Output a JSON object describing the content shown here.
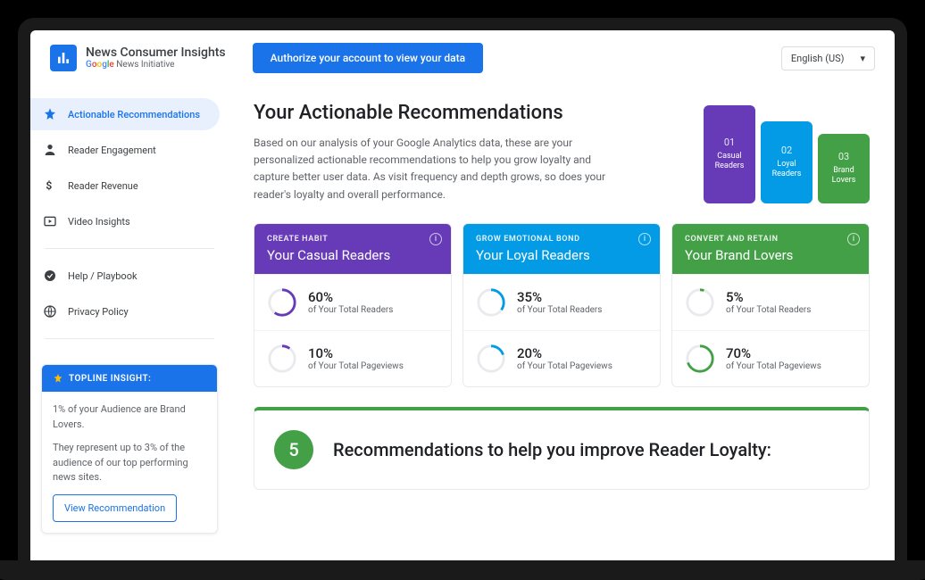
{
  "header": {
    "title": "News Consumer Insights",
    "subtitle_suffix": " News Initiative",
    "auth_button": "Authorize your account to view your data",
    "language": "English (US)"
  },
  "sidebar": {
    "items": [
      {
        "label": "Actionable Recommendations"
      },
      {
        "label": "Reader Engagement"
      },
      {
        "label": "Reader Revenue"
      },
      {
        "label": "Video Insights"
      },
      {
        "label": "Help / Playbook"
      },
      {
        "label": "Privacy Policy"
      }
    ],
    "insight": {
      "header": "TOPLINE INSIGHT:",
      "line1": "1% of your Audience are Brand Lovers.",
      "line2": "They represent up to 3% of the audience of our top performing news sites.",
      "cta": "View Recommendation"
    }
  },
  "main": {
    "title": "Your Actionable Recommendations",
    "intro": "Based on our analysis of your Google Analytics data, these are your personalized actionable recommendations to help you grow loyalty and capture better user data. As visit frequency and depth grows, so does your reader's loyalty and overall performance.",
    "pillars": [
      {
        "num": "01",
        "label": "Casual Readers"
      },
      {
        "num": "02",
        "label": "Loyal Readers"
      },
      {
        "num": "03",
        "label": "Brand Lovers"
      }
    ],
    "cards": [
      {
        "tag": "CREATE HABIT",
        "title": "Your Casual Readers",
        "rows": [
          {
            "value": "60%",
            "label": "of Your Total Readers",
            "pct": 60
          },
          {
            "value": "10%",
            "label": "of Your Total Pageviews",
            "pct": 10
          }
        ],
        "color": "#673ab7"
      },
      {
        "tag": "GROW EMOTIONAL BOND",
        "title": "Your Loyal Readers",
        "rows": [
          {
            "value": "35%",
            "label": "of Your Total Readers",
            "pct": 35
          },
          {
            "value": "20%",
            "label": "of Your Total Pageviews",
            "pct": 20
          }
        ],
        "color": "#039be5"
      },
      {
        "tag": "CONVERT AND RETAIN",
        "title": "Your Brand Lovers",
        "rows": [
          {
            "value": "5%",
            "label": "of Your Total Readers",
            "pct": 5
          },
          {
            "value": "70%",
            "label": "of Your Total Pageviews",
            "pct": 70
          }
        ],
        "color": "#43a047"
      }
    ],
    "rec_count": "5",
    "rec_title": "Recommendations to help you improve Reader Loyalty:"
  }
}
